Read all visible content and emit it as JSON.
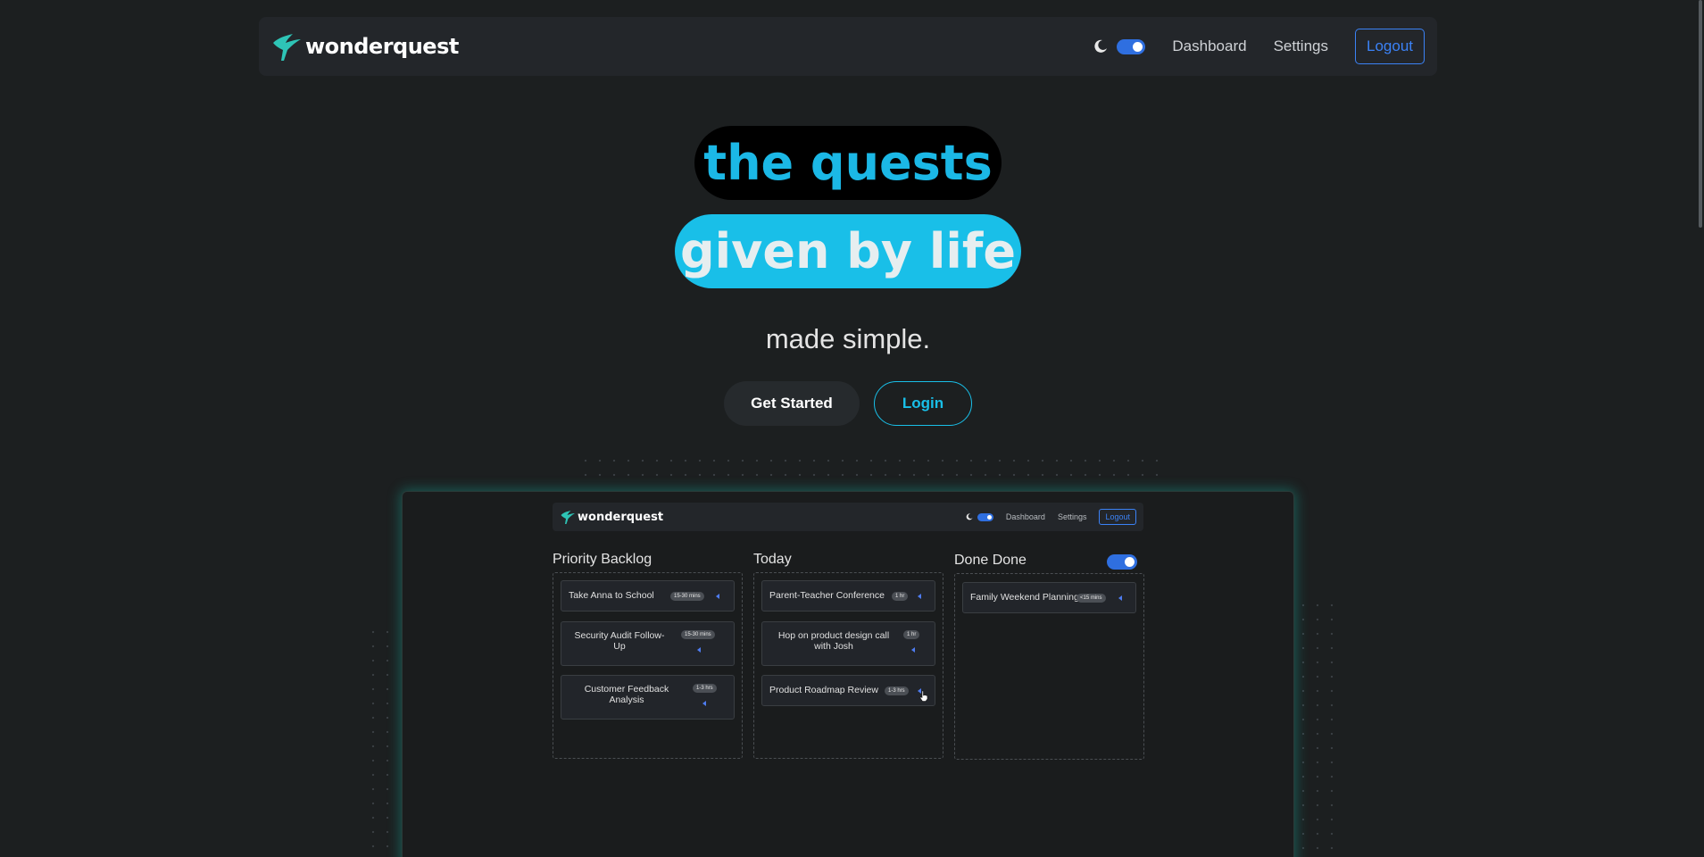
{
  "nav": {
    "brand": "wonderquest",
    "links": [
      "Dashboard",
      "Settings"
    ],
    "logout": "Logout"
  },
  "hero": {
    "line1": "the quests",
    "line2": "given by life",
    "tagline": "made simple.",
    "get_started": "Get Started",
    "login": "Login"
  },
  "preview": {
    "brand": "wonderquest",
    "links": [
      "Dashboard",
      "Settings"
    ],
    "logout": "Logout",
    "columns": [
      {
        "title": "Priority Backlog",
        "cards": [
          {
            "label": "Take Anna to School",
            "badge": "15-30 mins"
          },
          {
            "label": "Security Audit Follow-Up",
            "badge": "15-30 mins"
          },
          {
            "label": "Customer Feedback Analysis",
            "badge": "1-3 hrs"
          }
        ]
      },
      {
        "title": "Today",
        "cards": [
          {
            "label": "Parent-Teacher Conference",
            "badge": "1 hr"
          },
          {
            "label": "Hop on product design call with Josh",
            "badge": "1 hr"
          },
          {
            "label": "Product Roadmap Review",
            "badge": "1-3 hrs"
          }
        ]
      },
      {
        "title": "Done Done",
        "cards": [
          {
            "label": "Family Weekend Planning",
            "badge": "<15 mins"
          }
        ]
      }
    ]
  },
  "colors": {
    "background": "#1c1f20",
    "accent_cyan": "#19bfe8",
    "accent_blue": "#3b82f6",
    "brand_teal": "#2ec4b6"
  }
}
